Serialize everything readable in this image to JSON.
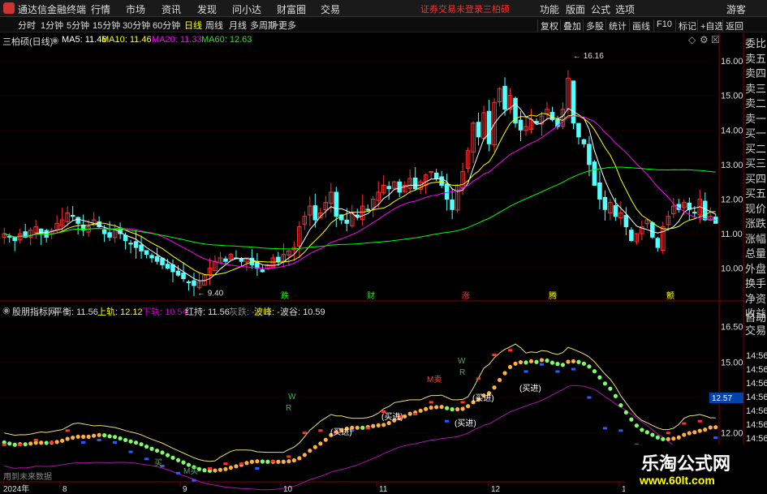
{
  "app": {
    "title": "通达信金融终端"
  },
  "menu": [
    "行情",
    "市场",
    "资讯",
    "发现",
    "问小达",
    "财富圈",
    "交易"
  ],
  "status": {
    "login": "证券交易未登录",
    "stock": "三柏硕"
  },
  "menu_right": [
    "功能",
    "版面",
    "公式",
    "选项"
  ],
  "guest": "游客",
  "timeframes": [
    "分时",
    "1分钟",
    "5分钟",
    "15分钟",
    "30分钟",
    "60分钟",
    "日线",
    "周线",
    "月线",
    "多周期",
    "更多"
  ],
  "toolbar": [
    "复权",
    "叠加",
    "多股",
    "统计",
    "画线",
    "F10",
    "标记",
    "+自选",
    "返回"
  ],
  "right_panel": [
    "委比",
    "卖五",
    "卖四",
    "卖三",
    "卖二",
    "卖一",
    "买一",
    "买二",
    "买三",
    "买四",
    "买五",
    "现价",
    "涨跌",
    "涨幅",
    "总量",
    "外盘",
    "换手",
    "净资",
    "收益"
  ],
  "right_panel2": [
    "自动",
    "交易"
  ],
  "main_chart": {
    "title": "三柏硕(日线)",
    "ma": [
      {
        "label": "MA5: 11.46",
        "color": "#ffffff"
      },
      {
        "label": "MA10: 11.46",
        "color": "#ffff00"
      },
      {
        "label": "MA20: 11.33",
        "color": "#ff00ff"
      },
      {
        "label": "MA60: 12.63",
        "color": "#00ff00"
      }
    ],
    "high_label": "16.16",
    "low_label": "9.40",
    "markers": [
      "跌",
      "财",
      "涨",
      "腾",
      "颤"
    ]
  },
  "chart_data": [
    {
      "type": "candlestick",
      "title": "三柏硕(日线)",
      "ylim": [
        9.5,
        16.4
      ],
      "yticks": [
        10.0,
        11.0,
        12.0,
        13.0,
        14.0,
        15.0,
        16.0
      ],
      "x_labels": [
        "2024年",
        "8",
        "9",
        "10",
        "11",
        "12",
        "1"
      ],
      "closes": [
        11.0,
        10.9,
        10.8,
        11.0,
        10.9,
        11.1,
        11.2,
        11.0,
        10.9,
        11.1,
        11.3,
        11.4,
        11.6,
        11.5,
        11.3,
        11.1,
        11.2,
        11.4,
        11.2,
        11.0,
        10.9,
        11.1,
        11.0,
        10.8,
        10.7,
        10.6,
        10.5,
        10.4,
        10.3,
        10.2,
        10.1,
        10.0,
        9.9,
        9.8,
        9.7,
        9.6,
        9.5,
        9.6,
        9.8,
        10.0,
        10.2,
        10.3,
        10.2,
        10.4,
        10.3,
        10.2,
        10.3,
        10.1,
        10.0,
        9.9,
        10.1,
        10.3,
        10.2,
        10.4,
        10.5,
        10.6,
        11.2,
        11.5,
        11.8,
        11.4,
        11.6,
        11.9,
        12.2,
        11.5,
        11.4,
        11.3,
        11.6,
        11.5,
        11.8,
        11.7,
        12.0,
        12.2,
        12.4,
        12.3,
        12.5,
        12.2,
        12.4,
        12.6,
        12.3,
        12.5,
        12.7,
        12.8,
        12.6,
        12.4,
        12.0,
        11.7,
        12.4,
        12.8,
        13.4,
        14.2,
        13.8,
        14.5,
        13.6,
        14.8,
        15.2,
        14.6,
        15.0,
        14.2,
        14.0,
        14.1,
        14.3,
        14.2,
        14.4,
        14.6,
        14.3,
        14.1,
        14.6,
        15.5,
        14.2,
        13.8,
        13.6,
        13.0,
        12.4,
        12.0,
        11.7,
        11.9,
        11.5,
        11.6,
        11.2,
        10.8,
        11.0,
        11.2,
        11.4,
        10.9,
        10.6,
        11.2,
        11.5,
        11.8,
        11.7,
        11.9,
        11.7,
        11.6,
        12.0,
        11.4,
        11.5,
        11.3
      ],
      "ma5": 11.46,
      "ma10": 11.46,
      "ma20": 11.33,
      "ma60": 12.63,
      "high": 16.16,
      "low": 9.4
    },
    {
      "type": "line",
      "title": "股朋指标网",
      "legend": [
        "平衡: 11.56",
        "上轨: 12.12",
        "下轨: 10.54",
        "红持: 11.56",
        "灰跌: -",
        "波峰: -",
        "波谷: 10.59"
      ],
      "ylim": [
        10.0,
        17.0
      ],
      "yticks": [
        12.0,
        13.5,
        15.0,
        16.5
      ],
      "time_ticks": [
        "14:56",
        "14:56",
        "14:56",
        "14:56",
        "14:56",
        "14:56",
        "14:56",
        "14:56"
      ],
      "last_value": "12.57",
      "annotations": [
        "W",
        "R",
        "M卖",
        "W",
        "R",
        "(买进)",
        "(买进)",
        "(买进)",
        "(买进)",
        "(买进)",
        "买",
        "M买"
      ],
      "footer": "用到未来数据"
    }
  ],
  "watermark": {
    "line1": "乐淘公式网",
    "line2": "www.60lt.com"
  }
}
